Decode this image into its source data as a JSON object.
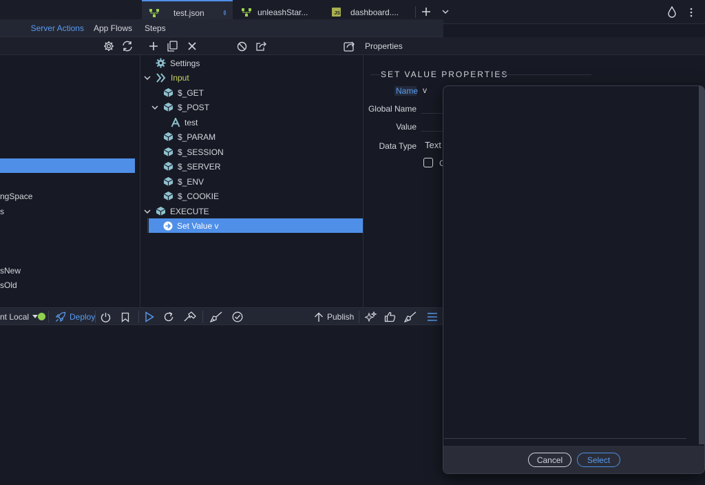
{
  "tabs": [
    {
      "label": "test.json",
      "active": true,
      "modified": true
    },
    {
      "label": "unleashStar...",
      "active": false
    },
    {
      "label": "dashboard....",
      "active": false
    }
  ],
  "left_panel": {
    "server_actions": "Server Actions",
    "app_flows": "App Flows",
    "items": [
      "ngSpace",
      "s",
      "sNew",
      "sOld"
    ]
  },
  "steps": {
    "title": "Steps",
    "tree": {
      "settings": "Settings",
      "input": "Input",
      "get": "$_GET",
      "post": "$_POST",
      "test": "test",
      "param": "$_PARAM",
      "session": "$_SESSION",
      "server": "$_SERVER",
      "env": "$_ENV",
      "cookie": "$_COOKIE",
      "execute": "EXECUTE",
      "set_value": "Set Value v"
    }
  },
  "properties": {
    "title": "Properties",
    "section": "SET VALUE PROPERTIES",
    "name_label": "Name",
    "name_value": "v",
    "global_name_label": "Global Name",
    "value_label": "Value",
    "data_type_label": "Data Type",
    "data_type_value": "Text",
    "checkbox_partial": "C"
  },
  "bottom_bar": {
    "target": "nt Local",
    "deploy": "Deploy",
    "publish": "Publish"
  },
  "modal": {
    "cancel": "Cancel",
    "select": "Select"
  },
  "colors": {
    "accent": "#4f8fe8",
    "status_green": "#8fd14f",
    "input_yellow": "#c9d368",
    "cube_teal": "#8fc1cf"
  }
}
